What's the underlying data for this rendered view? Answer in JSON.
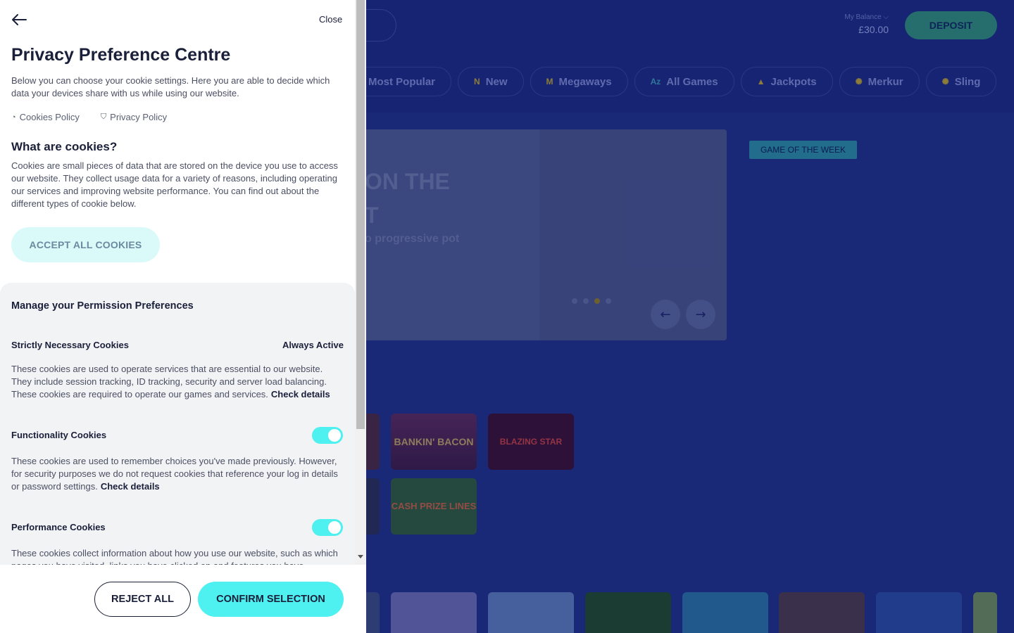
{
  "site": {
    "balance_label": "My Balance ⌵",
    "balance_value": "£30.00",
    "deposit_label": "DEPOSIT",
    "categories": [
      {
        "label": "Most Popular",
        "icon": "star-icon"
      },
      {
        "label": "New",
        "icon": "n-icon"
      },
      {
        "label": "Megaways",
        "icon": "m-icon"
      },
      {
        "label": "All Games",
        "icon": "az-icon"
      },
      {
        "label": "Jackpots",
        "icon": "jackpot-icon"
      },
      {
        "label": "Merkur",
        "icon": "sun-icon"
      },
      {
        "label": "Sling",
        "icon": "sun-icon"
      }
    ],
    "hero": {
      "title_line1": "ON THE",
      "title_line2": "T",
      "subtitle": "o progressive pot"
    },
    "game_of_week_label": "GAME OF THE WEEK",
    "tiles": {
      "bankin": "BANKIN' BACON",
      "blazing": "BLAZING STAR",
      "cash": "CASH PRIZE LINES"
    }
  },
  "privacy": {
    "close_label": "Close",
    "title": "Privacy Preference Centre",
    "intro": "Below you can choose your cookie settings. Here you are able to decide which data your devices share with us while using our website.",
    "cookies_policy_label": "Cookies Policy",
    "privacy_policy_label": "Privacy Policy",
    "what_are_cookies_heading": "What are cookies?",
    "what_are_cookies_text": "Cookies are small pieces of data that are stored on the device you use to access our website. They collect usage data for a variety of reasons, including operating our services and improving website performance. You can find out about the different types of cookie below.",
    "accept_all_label": "ACCEPT ALL COOKIES",
    "manage_heading": "Manage your Permission Preferences",
    "categories": [
      {
        "name": "Strictly Necessary Cookies",
        "status": "Always Active",
        "description": "These cookies are used to operate services that are essential to our website. They include session tracking, ID tracking, security and server load balancing. These cookies are required to operate our games and services.",
        "link": "Check details"
      },
      {
        "name": "Functionality Cookies",
        "enabled": true,
        "description": "These cookies are used to remember choices you've made previously. However, for security purposes we do not request cookies that reference your log in details or password settings.",
        "link": "Check details"
      },
      {
        "name": "Performance Cookies",
        "enabled": true,
        "description": "These cookies collect information about how you use our website, such as which pages you have visited, links you have clicked on and features you have"
      }
    ],
    "reject_all_label": "REJECT ALL",
    "confirm_label": "CONFIRM SELECTION"
  },
  "colors": {
    "accent": "#4ff0f0",
    "panel_bg": "#ffffff",
    "prefs_bg": "#f2f3f5",
    "site_bg": "#1f2f86",
    "deposit": "#2f8d77"
  }
}
